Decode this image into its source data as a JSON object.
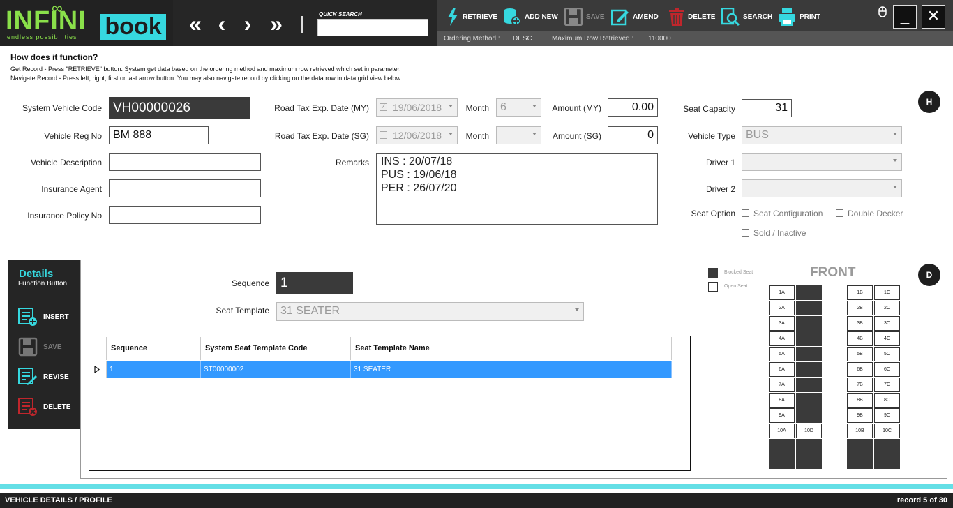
{
  "brand": {
    "infini": "INFINI",
    "book": "book",
    "tagline": "endless possibilities",
    "infinity": "∞"
  },
  "nav": {
    "first": "«",
    "prev": "‹",
    "next": "›",
    "last": "»"
  },
  "quick_search": {
    "label": "QUICK SEARCH",
    "value": ""
  },
  "toolbar": {
    "retrieve": "RETRIEVE",
    "add_new": "ADD NEW",
    "save": "SAVE",
    "amend": "AMEND",
    "delete": "DELETE",
    "search": "SEARCH",
    "print": "PRINT"
  },
  "window": {
    "minimize": "_",
    "close": "✕"
  },
  "status": {
    "ordering_label": "Ordering Method :",
    "ordering_value": "DESC",
    "maxrow_label": "Maximum Row Retrieved :",
    "maxrow_value": "110000"
  },
  "howto": {
    "title": "How does it function?",
    "line1": "Get Record - Press \"RETRIEVE\" button. System get data based on the ordering method and maximum row retrieved which set in parameter.",
    "line2": "Navigate Record - Press left, right, first or last arrow button. You may also navigate record by clicking on the data row in data grid view below."
  },
  "form": {
    "system_vehicle_code_label": "System Vehicle Code",
    "system_vehicle_code": "VH00000026",
    "vehicle_reg_no_label": "Vehicle Reg No",
    "vehicle_reg_no": "BM 888",
    "vehicle_description_label": "Vehicle Description",
    "vehicle_description": "",
    "insurance_agent_label": "Insurance Agent",
    "insurance_agent": "",
    "insurance_policy_no_label": "Insurance Policy No",
    "insurance_policy_no": "",
    "road_tax_my_label": "Road Tax Exp. Date (MY)",
    "road_tax_my": "19/06/2018",
    "road_tax_sg_label": "Road Tax Exp. Date (SG)",
    "road_tax_sg": "12/06/2018",
    "month_label": "Month",
    "month_my": "6",
    "month_sg": "",
    "amount_my_label": "Amount (MY)",
    "amount_my": "0.00",
    "amount_sg_label": "Amount (SG)",
    "amount_sg": "0",
    "remarks_label": "Remarks",
    "remarks": "INS : 20/07/18\nPUS : 19/06/18\nPER : 26/07/20",
    "seat_capacity_label": "Seat Capacity",
    "seat_capacity": "31",
    "vehicle_type_label": "Vehicle Type",
    "vehicle_type": "BUS",
    "driver1_label": "Driver 1",
    "driver1": "",
    "driver2_label": "Driver 2",
    "driver2": "",
    "seat_option_label": "Seat Option",
    "seat_configuration": "Seat Configuration",
    "double_decker": "Double Decker",
    "sold_inactive": "Sold / Inactive"
  },
  "circle": {
    "h": "H",
    "d": "D"
  },
  "details": {
    "title": "Details",
    "subtitle": "Function Button",
    "insert": "INSERT",
    "save": "SAVE",
    "revise": "REVISE",
    "delete": "DELETE",
    "sequence_label": "Sequence",
    "sequence": "1",
    "seat_template_label": "Seat Template",
    "seat_template": "31 SEATER"
  },
  "grid": {
    "headers": [
      "Sequence",
      "System Seat Template Code",
      "Seat Template Name"
    ],
    "rows": [
      [
        "1",
        "ST00000002",
        "31 SEATER"
      ]
    ]
  },
  "seat_map": {
    "front": "FRONT",
    "blocked": "Blocked Seat",
    "open": "Open Seat",
    "left": [
      "1A",
      "2A",
      "3A",
      "4A",
      "5A",
      "6A",
      "7A",
      "8A",
      "9A",
      "10A"
    ],
    "aisle_last": "10D",
    "right_b": [
      "1B",
      "2B",
      "3B",
      "4B",
      "5B",
      "6B",
      "7B",
      "8B",
      "9B",
      "10B"
    ],
    "right_c": [
      "1C",
      "2C",
      "3C",
      "4C",
      "5C",
      "6C",
      "7C",
      "8C",
      "9C",
      "10C"
    ]
  },
  "footer": {
    "title": "VEHICLE DETAILS / PROFILE",
    "record": "record 5 of 30"
  },
  "colors": {
    "accent": "#36d8df",
    "brand_green": "#8ae04a",
    "selected_row": "#3399ff",
    "delete_red": "#c0262c"
  }
}
